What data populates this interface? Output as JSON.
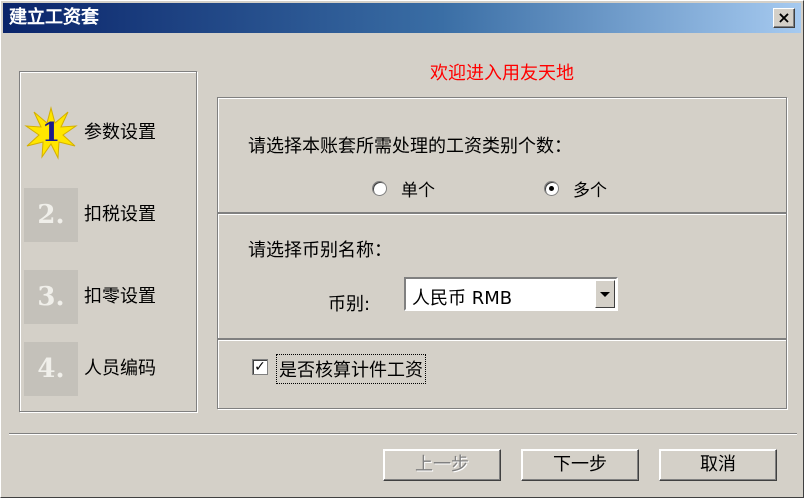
{
  "window": {
    "title": "建立工资套",
    "close_glyph": "×"
  },
  "steps": [
    {
      "number": "1",
      "label": "参数设置",
      "active": true
    },
    {
      "number": "2",
      "label": "扣税设置",
      "active": false
    },
    {
      "number": "3",
      "label": "扣零设置",
      "active": false
    },
    {
      "number": "4",
      "label": "人员编码",
      "active": false
    }
  ],
  "welcome": "欢迎进入用友天地",
  "category_group": {
    "question": "请选择本账套所需处理的工资类别个数：",
    "options": [
      {
        "label": "单个",
        "selected": false
      },
      {
        "label": "多个",
        "selected": true
      }
    ]
  },
  "currency_group": {
    "question": "请选择币别名称：",
    "field_label": "币别:",
    "value": "人民币 RMB"
  },
  "piecework": {
    "label": "是否核算计件工资",
    "checked": true,
    "check_glyph": "✓"
  },
  "buttons": {
    "prev": "上一步",
    "next": "下一步",
    "cancel": "取消"
  },
  "colors": {
    "welcome": "#ff0000",
    "active_step": "#1a1a8c",
    "title_bar": "#0a246a"
  }
}
